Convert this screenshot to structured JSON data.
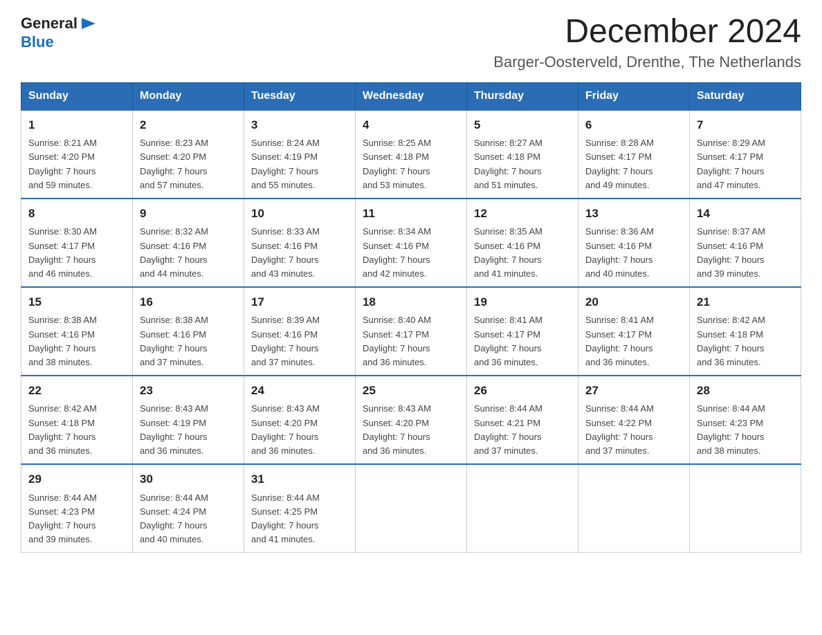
{
  "header": {
    "title": "December 2024",
    "subtitle": "Barger-Oosterveld, Drenthe, The Netherlands",
    "logo_general": "General",
    "logo_blue": "Blue"
  },
  "weekdays": [
    "Sunday",
    "Monday",
    "Tuesday",
    "Wednesday",
    "Thursday",
    "Friday",
    "Saturday"
  ],
  "weeks": [
    [
      {
        "day": "1",
        "sunrise": "8:21 AM",
        "sunset": "4:20 PM",
        "daylight": "7 hours and 59 minutes."
      },
      {
        "day": "2",
        "sunrise": "8:23 AM",
        "sunset": "4:20 PM",
        "daylight": "7 hours and 57 minutes."
      },
      {
        "day": "3",
        "sunrise": "8:24 AM",
        "sunset": "4:19 PM",
        "daylight": "7 hours and 55 minutes."
      },
      {
        "day": "4",
        "sunrise": "8:25 AM",
        "sunset": "4:18 PM",
        "daylight": "7 hours and 53 minutes."
      },
      {
        "day": "5",
        "sunrise": "8:27 AM",
        "sunset": "4:18 PM",
        "daylight": "7 hours and 51 minutes."
      },
      {
        "day": "6",
        "sunrise": "8:28 AM",
        "sunset": "4:17 PM",
        "daylight": "7 hours and 49 minutes."
      },
      {
        "day": "7",
        "sunrise": "8:29 AM",
        "sunset": "4:17 PM",
        "daylight": "7 hours and 47 minutes."
      }
    ],
    [
      {
        "day": "8",
        "sunrise": "8:30 AM",
        "sunset": "4:17 PM",
        "daylight": "7 hours and 46 minutes."
      },
      {
        "day": "9",
        "sunrise": "8:32 AM",
        "sunset": "4:16 PM",
        "daylight": "7 hours and 44 minutes."
      },
      {
        "day": "10",
        "sunrise": "8:33 AM",
        "sunset": "4:16 PM",
        "daylight": "7 hours and 43 minutes."
      },
      {
        "day": "11",
        "sunrise": "8:34 AM",
        "sunset": "4:16 PM",
        "daylight": "7 hours and 42 minutes."
      },
      {
        "day": "12",
        "sunrise": "8:35 AM",
        "sunset": "4:16 PM",
        "daylight": "7 hours and 41 minutes."
      },
      {
        "day": "13",
        "sunrise": "8:36 AM",
        "sunset": "4:16 PM",
        "daylight": "7 hours and 40 minutes."
      },
      {
        "day": "14",
        "sunrise": "8:37 AM",
        "sunset": "4:16 PM",
        "daylight": "7 hours and 39 minutes."
      }
    ],
    [
      {
        "day": "15",
        "sunrise": "8:38 AM",
        "sunset": "4:16 PM",
        "daylight": "7 hours and 38 minutes."
      },
      {
        "day": "16",
        "sunrise": "8:38 AM",
        "sunset": "4:16 PM",
        "daylight": "7 hours and 37 minutes."
      },
      {
        "day": "17",
        "sunrise": "8:39 AM",
        "sunset": "4:16 PM",
        "daylight": "7 hours and 37 minutes."
      },
      {
        "day": "18",
        "sunrise": "8:40 AM",
        "sunset": "4:17 PM",
        "daylight": "7 hours and 36 minutes."
      },
      {
        "day": "19",
        "sunrise": "8:41 AM",
        "sunset": "4:17 PM",
        "daylight": "7 hours and 36 minutes."
      },
      {
        "day": "20",
        "sunrise": "8:41 AM",
        "sunset": "4:17 PM",
        "daylight": "7 hours and 36 minutes."
      },
      {
        "day": "21",
        "sunrise": "8:42 AM",
        "sunset": "4:18 PM",
        "daylight": "7 hours and 36 minutes."
      }
    ],
    [
      {
        "day": "22",
        "sunrise": "8:42 AM",
        "sunset": "4:18 PM",
        "daylight": "7 hours and 36 minutes."
      },
      {
        "day": "23",
        "sunrise": "8:43 AM",
        "sunset": "4:19 PM",
        "daylight": "7 hours and 36 minutes."
      },
      {
        "day": "24",
        "sunrise": "8:43 AM",
        "sunset": "4:20 PM",
        "daylight": "7 hours and 36 minutes."
      },
      {
        "day": "25",
        "sunrise": "8:43 AM",
        "sunset": "4:20 PM",
        "daylight": "7 hours and 36 minutes."
      },
      {
        "day": "26",
        "sunrise": "8:44 AM",
        "sunset": "4:21 PM",
        "daylight": "7 hours and 37 minutes."
      },
      {
        "day": "27",
        "sunrise": "8:44 AM",
        "sunset": "4:22 PM",
        "daylight": "7 hours and 37 minutes."
      },
      {
        "day": "28",
        "sunrise": "8:44 AM",
        "sunset": "4:23 PM",
        "daylight": "7 hours and 38 minutes."
      }
    ],
    [
      {
        "day": "29",
        "sunrise": "8:44 AM",
        "sunset": "4:23 PM",
        "daylight": "7 hours and 39 minutes."
      },
      {
        "day": "30",
        "sunrise": "8:44 AM",
        "sunset": "4:24 PM",
        "daylight": "7 hours and 40 minutes."
      },
      {
        "day": "31",
        "sunrise": "8:44 AM",
        "sunset": "4:25 PM",
        "daylight": "7 hours and 41 minutes."
      },
      null,
      null,
      null,
      null
    ]
  ],
  "labels": {
    "sunrise": "Sunrise:",
    "sunset": "Sunset:",
    "daylight": "Daylight:"
  }
}
